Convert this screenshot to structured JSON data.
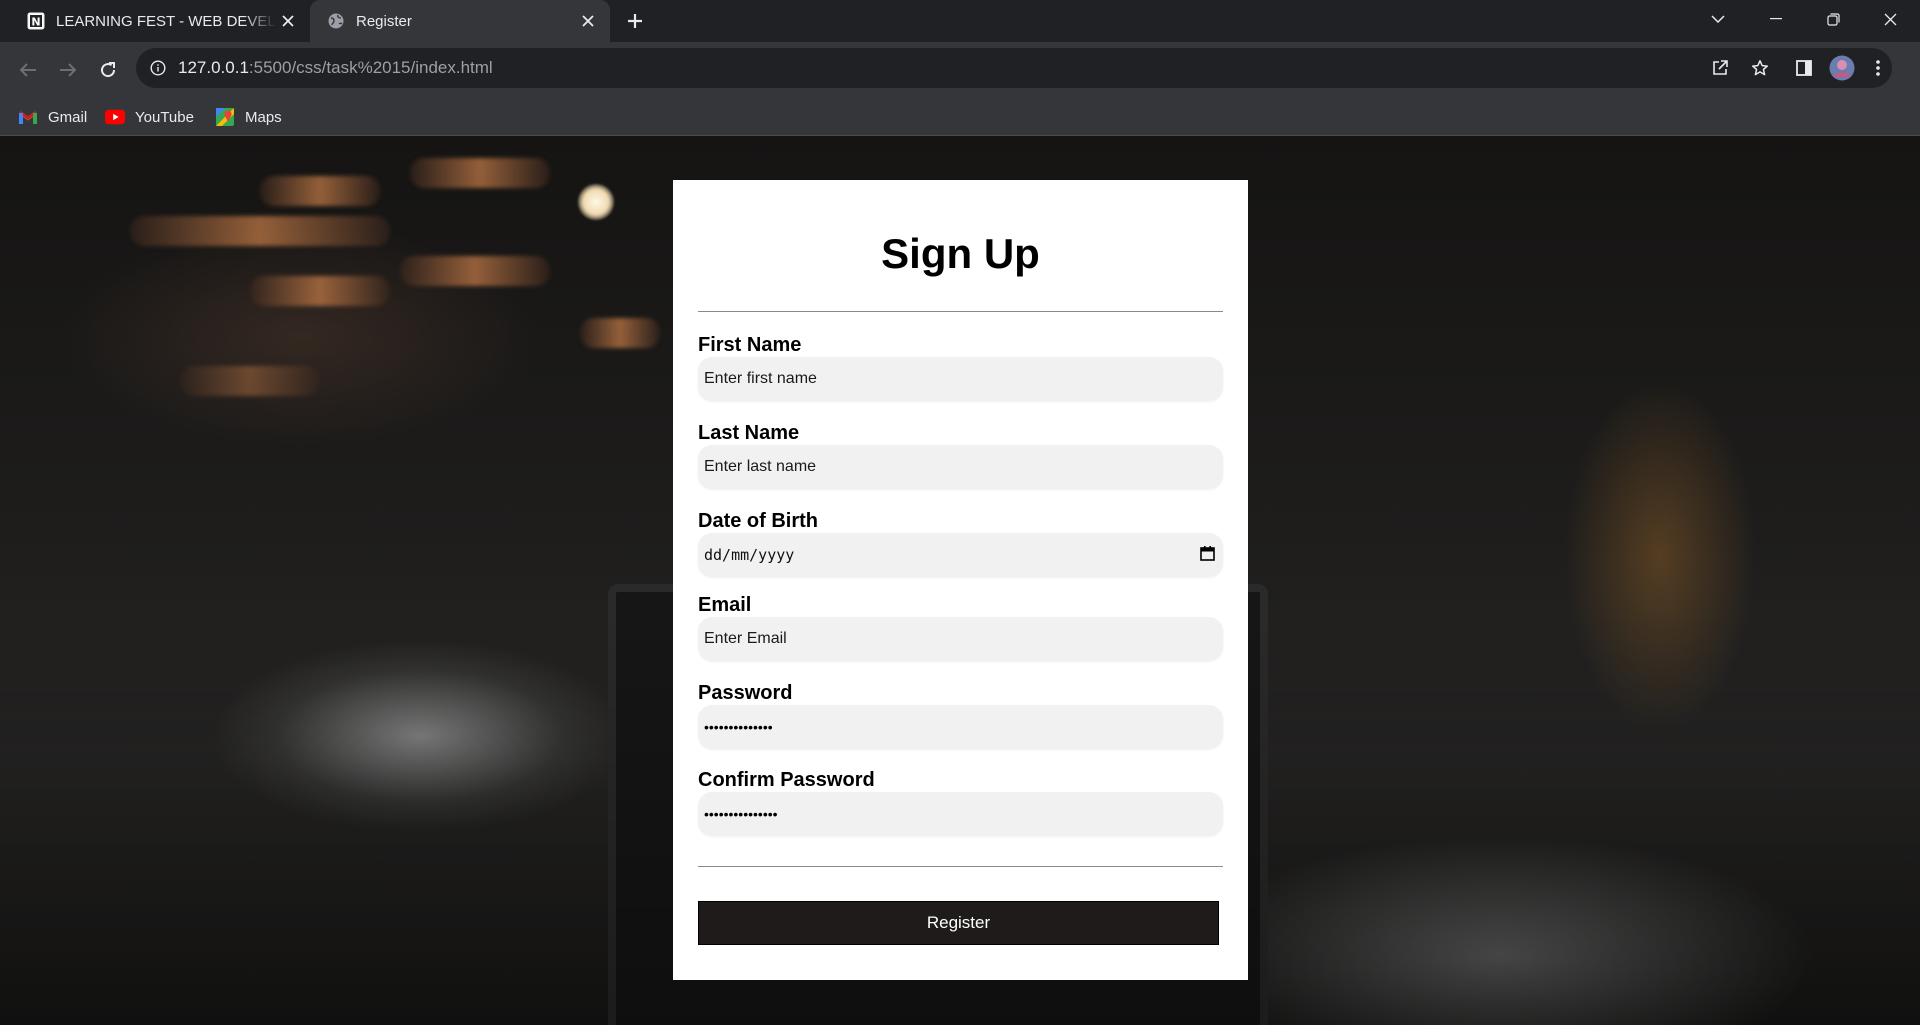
{
  "browser": {
    "tabs": [
      {
        "title": "LEARNING FEST - WEB DEVELOP",
        "active": false,
        "icon": "notion-icon"
      },
      {
        "title": "Register",
        "active": true,
        "icon": "globe-icon"
      }
    ],
    "address": {
      "host": "127.0.0.1",
      "rest": ":5500/css/task%2015/index.html"
    },
    "bookmarks": [
      {
        "label": "Gmail",
        "icon": "gmail-icon"
      },
      {
        "label": "YouTube",
        "icon": "youtube-icon"
      },
      {
        "label": "Maps",
        "icon": "maps-icon"
      }
    ]
  },
  "form": {
    "title": "Sign Up",
    "first_name": {
      "label": "First Name",
      "placeholder": "Enter first name"
    },
    "last_name": {
      "label": "Last Name",
      "placeholder": "Enter last name"
    },
    "dob": {
      "label": "Date of Birth",
      "placeholder": "dd/mm/yyyy"
    },
    "email": {
      "label": "Email",
      "placeholder": "Enter Email"
    },
    "password": {
      "label": "Password",
      "value": "••••••••••••••"
    },
    "confirm_password": {
      "label": "Confirm Password",
      "value": "•••••••••••••••"
    },
    "submit_label": "Register"
  },
  "colors": {
    "chrome_dark": "#202124",
    "chrome_toolbar": "#35363a",
    "button_bg": "#1e1b1a",
    "input_bg": "#f1f1f1"
  }
}
